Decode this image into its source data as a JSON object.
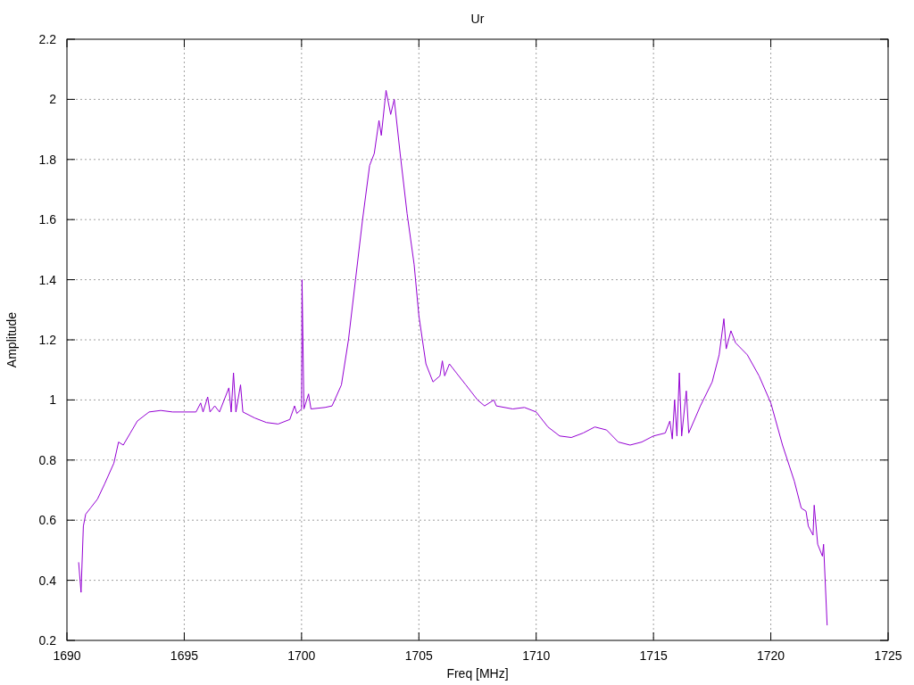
{
  "chart_data": {
    "type": "line",
    "title": "Ur",
    "xlabel": "Freq [MHz]",
    "ylabel": "Amplitude",
    "xlim": [
      1690,
      1725
    ],
    "ylim": [
      0.2,
      2.2
    ],
    "grid": true,
    "xticks": [
      1690,
      1695,
      1700,
      1705,
      1710,
      1715,
      1720,
      1725
    ],
    "yticks": [
      0.2,
      0.4,
      0.6,
      0.8,
      1,
      1.2,
      1.4,
      1.6,
      1.8,
      2,
      2.2
    ],
    "x": [
      1690.5,
      1690.6,
      1690.7,
      1690.8,
      1691,
      1691.3,
      1691.6,
      1692,
      1692.2,
      1692.4,
      1692.7,
      1693,
      1693.5,
      1694,
      1694.5,
      1695,
      1695.5,
      1695.7,
      1695.8,
      1696,
      1696.1,
      1696.3,
      1696.5,
      1696.9,
      1697,
      1697.1,
      1697.2,
      1697.4,
      1697.5,
      1698,
      1698.5,
      1699,
      1699.5,
      1699.7,
      1699.8,
      1700,
      1700.02,
      1700.1,
      1700.3,
      1700.4,
      1701,
      1701.3,
      1701.7,
      1702,
      1702.3,
      1702.6,
      1702.9,
      1703.1,
      1703.3,
      1703.4,
      1703.6,
      1703.8,
      1703.95,
      1704.2,
      1704.5,
      1704.8,
      1705,
      1705.3,
      1705.6,
      1705.9,
      1706,
      1706.1,
      1706.3,
      1706.6,
      1707,
      1707.5,
      1707.8,
      1708.2,
      1708.3,
      1709,
      1709.5,
      1710,
      1710.5,
      1711,
      1711.5,
      1712,
      1712.5,
      1713,
      1713.5,
      1714,
      1714.5,
      1715,
      1715.5,
      1715.7,
      1715.8,
      1715.9,
      1716,
      1716.1,
      1716.2,
      1716.4,
      1716.5,
      1717,
      1717.5,
      1717.8,
      1718,
      1718.1,
      1718.3,
      1718.5,
      1719,
      1719.5,
      1720,
      1720.5,
      1721,
      1721.3,
      1721.5,
      1721.6,
      1721.8,
      1721.85,
      1722,
      1722.2,
      1722.25,
      1722.4
    ],
    "series": [
      {
        "color": "#9400d3",
        "values": [
          0.46,
          0.36,
          0.58,
          0.62,
          0.64,
          0.67,
          0.72,
          0.79,
          0.86,
          0.85,
          0.89,
          0.93,
          0.96,
          0.965,
          0.96,
          0.96,
          0.96,
          0.99,
          0.96,
          1.01,
          0.96,
          0.98,
          0.96,
          1.04,
          0.96,
          1.09,
          0.96,
          1.05,
          0.96,
          0.94,
          0.925,
          0.92,
          0.935,
          0.98,
          0.955,
          0.97,
          1.4,
          0.97,
          1.02,
          0.97,
          0.975,
          0.98,
          1.05,
          1.2,
          1.4,
          1.6,
          1.78,
          1.82,
          1.93,
          1.88,
          2.03,
          1.95,
          2.0,
          1.82,
          1.62,
          1.45,
          1.28,
          1.12,
          1.06,
          1.08,
          1.13,
          1.08,
          1.12,
          1.09,
          1.05,
          1.0,
          0.98,
          1.0,
          0.98,
          0.97,
          0.975,
          0.96,
          0.91,
          0.88,
          0.875,
          0.89,
          0.91,
          0.9,
          0.86,
          0.85,
          0.86,
          0.88,
          0.89,
          0.93,
          0.87,
          1.0,
          0.88,
          1.09,
          0.88,
          1.03,
          0.89,
          0.98,
          1.06,
          1.15,
          1.27,
          1.17,
          1.23,
          1.19,
          1.15,
          1.08,
          0.99,
          0.85,
          0.73,
          0.64,
          0.63,
          0.58,
          0.55,
          0.65,
          0.52,
          0.48,
          0.52,
          0.25
        ]
      }
    ]
  }
}
